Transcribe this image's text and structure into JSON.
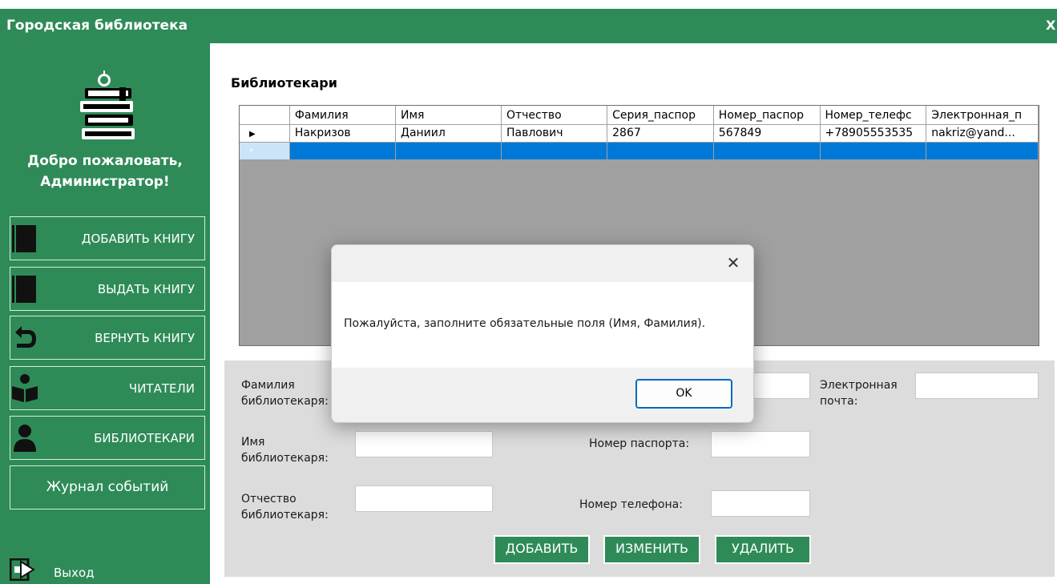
{
  "window": {
    "title": "Городская библиотека",
    "close_label": "X"
  },
  "sidebar": {
    "welcome_line1": "Добро пожаловать,",
    "welcome_line2": "Администратор!",
    "items": [
      {
        "label": "ДОБАВИТЬ КНИГУ",
        "icon": "book-icon"
      },
      {
        "label": "ВЫДАТЬ КНИГУ",
        "icon": "book-icon"
      },
      {
        "label": "ВЕРНУТЬ КНИГУ",
        "icon": "return-arrow-icon"
      },
      {
        "label": "ЧИТАТЕЛИ",
        "icon": "reader-icon"
      },
      {
        "label": "БИБЛИОТЕКАРИ",
        "icon": "librarian-icon"
      },
      {
        "label": "Журнал событий",
        "icon": ""
      }
    ],
    "exit_label": "Выход"
  },
  "main": {
    "title": "Библиотекари",
    "grid": {
      "columns": [
        "Фамилия",
        "Имя",
        "Отчество",
        "Серия_паспор",
        "Номер_паспор",
        "Номер_телефс",
        "Электронная_п"
      ],
      "rows": [
        [
          "Накризов",
          "Даниил",
          "Павлович",
          "2867",
          "567849",
          "+78905553535",
          "nakriz@yand..."
        ]
      ],
      "row_markers": [
        "▶",
        "*"
      ]
    },
    "form": {
      "surname_label": "Фамилия библиотекаря:",
      "surname_l1": "Фамилия",
      "surname_l2": "библиотекаря:",
      "name_l1": "Имя",
      "name_l2": "библиотекаря:",
      "patronymic_l1": "Отчество",
      "patronymic_l2": "библиотекаря:",
      "passport_number_label": "Номер паспорта:",
      "phone_label": "Номер телефона:",
      "email_l1": "Электронная",
      "email_l2": "почта:"
    },
    "actions": {
      "add": "ДОБАВИТЬ",
      "edit": "ИЗМЕНИТЬ",
      "delete": "УДАЛИТЬ"
    }
  },
  "dialog": {
    "message": "Пожалуйста, заполните обязательные поля (Имя, Фамилия).",
    "ok_label": "OK",
    "close_glyph": "✕"
  },
  "colors": {
    "accent": "#2e8b57",
    "selection": "#0078d7",
    "panel": "#dcdcdc"
  }
}
